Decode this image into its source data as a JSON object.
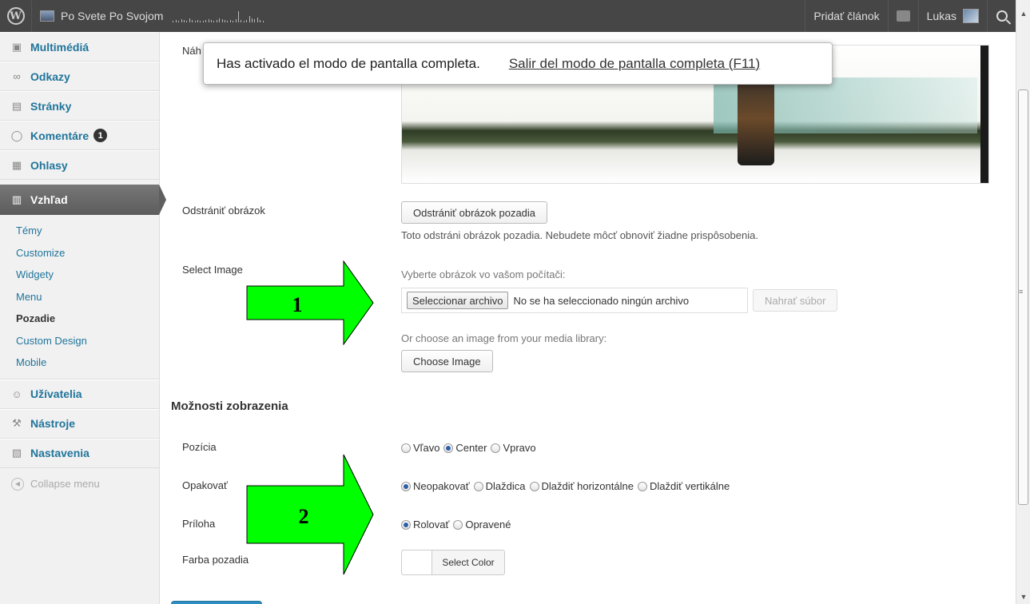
{
  "adminbar": {
    "site_name": "Po Svete Po Svojom",
    "add_post": "Pridať článok",
    "user_name": "Lukas"
  },
  "sidebar": {
    "items_top": [
      {
        "label": "Multimédiá",
        "icon": "media-icon"
      },
      {
        "label": "Odkazy",
        "icon": "links-icon"
      },
      {
        "label": "Stránky",
        "icon": "pages-icon"
      },
      {
        "label": "Komentáre",
        "icon": "comments-icon",
        "badge": "1"
      },
      {
        "label": "Ohlasy",
        "icon": "feedback-icon"
      }
    ],
    "current": {
      "label": "Vzhľad",
      "icon": "appearance-icon"
    },
    "submenu": [
      "Témy",
      "Customize",
      "Widgety",
      "Menu",
      "Pozadie",
      "Custom Design",
      "Mobile"
    ],
    "current_sub": "Pozadie",
    "items_bottom": [
      {
        "label": "Užívatelia",
        "icon": "users-icon"
      },
      {
        "label": "Nástroje",
        "icon": "tools-icon"
      },
      {
        "label": "Nastavenia",
        "icon": "settings-icon"
      }
    ],
    "collapse": "Collapse menu"
  },
  "toast": {
    "message": "Has activado el modo de pantalla completa.",
    "exit_link": "Salir del modo de pantalla completa (F11)"
  },
  "main": {
    "preview_label_partial": "Náh",
    "remove_label": "Odstrániť obrázok",
    "remove_button": "Odstrániť obrázok pozadia",
    "remove_help": "Toto odstráni obrázok pozadia. Nebudete môcť obnoviť žiadne prispôsobenia.",
    "select_label": "Select Image",
    "select_help": "Vyberte obrázok vo vašom počítači:",
    "file_button": "Seleccionar archivo",
    "file_status": "No se ha seleccionado ningún archivo",
    "upload_button": "Nahrať súbor",
    "library_help": "Or choose an image from your media library:",
    "choose_button": "Choose Image",
    "section_title": "Možnosti zobrazenia",
    "position": {
      "label": "Pozícia",
      "options": [
        "Vľavo",
        "Center",
        "Vpravo"
      ],
      "selected": 1
    },
    "repeat": {
      "label": "Opakovať",
      "options": [
        "Neopakovať",
        "Dlaždica",
        "Dlaždiť horizontálne",
        "Dlaždiť vertikálne"
      ],
      "selected": 0
    },
    "attachment": {
      "label": "Príloha",
      "options": [
        "Rolovať",
        "Opravené"
      ],
      "selected": 0
    },
    "color": {
      "label": "Farba pozadia",
      "button": "Select Color"
    }
  },
  "annotations": {
    "arrow1": "1",
    "arrow2": "2",
    "arrow_color": "#00ff00"
  }
}
